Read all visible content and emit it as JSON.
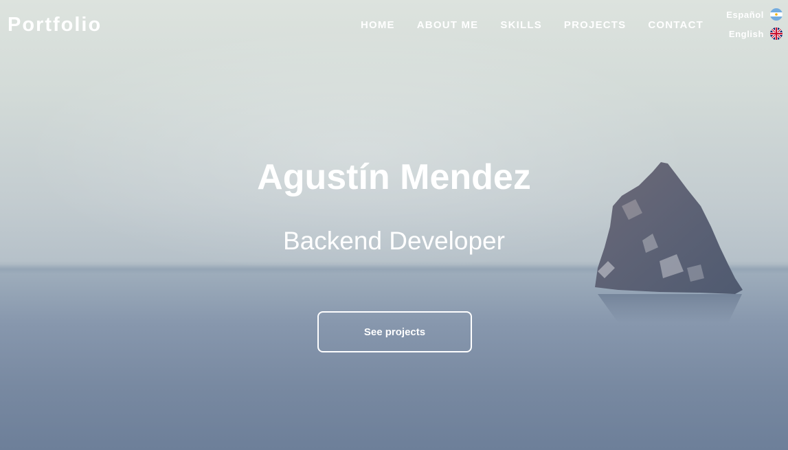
{
  "brand": {
    "title": "Portfolio"
  },
  "nav": {
    "items": [
      {
        "label": "HOME"
      },
      {
        "label": "ABOUT ME"
      },
      {
        "label": "SKILLS"
      },
      {
        "label": "PROJECTS"
      },
      {
        "label": "CONTACT"
      }
    ]
  },
  "languages": [
    {
      "label": "Español",
      "flag_icon": "argentina-flag-icon"
    },
    {
      "label": "English",
      "flag_icon": "uk-flag-icon"
    }
  ],
  "hero": {
    "name": "Agustín Mendez",
    "role": "Backend Developer",
    "cta_label": "See projects"
  },
  "colors": {
    "text": "#ffffff",
    "sky": "#dde3de",
    "sea": "#6d7f99",
    "rock": "#5c6478"
  }
}
